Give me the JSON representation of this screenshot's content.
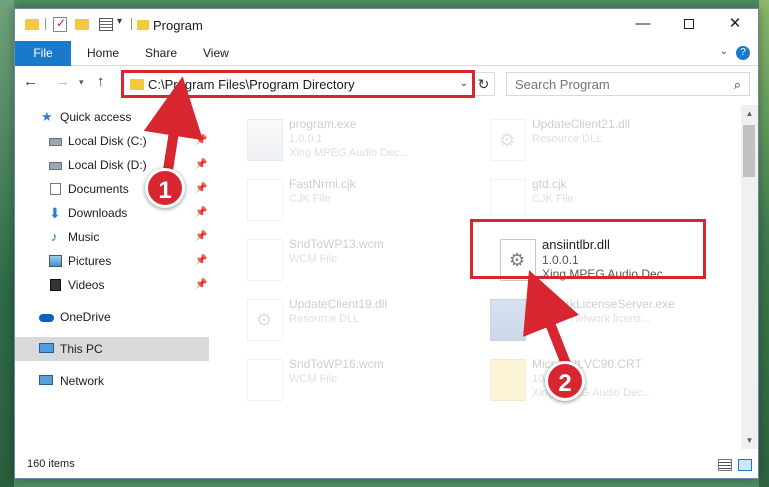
{
  "window": {
    "title": "Program",
    "minimize_icon": "minimize-icon",
    "maximize_icon": "maximize-icon",
    "close_icon": "close-icon"
  },
  "ribbon": {
    "tabs": [
      {
        "label": "File"
      },
      {
        "label": "Home"
      },
      {
        "label": "Share"
      },
      {
        "label": "View"
      }
    ],
    "help": "?"
  },
  "nav": {
    "address": "C:\\Program Files\\Program Directory",
    "search_placeholder": "Search Program"
  },
  "sidebar": {
    "items": [
      {
        "label": "Quick access",
        "icon": "star-icon"
      },
      {
        "label": "Local Disk (C:)",
        "icon": "disk-icon",
        "pinned": true
      },
      {
        "label": "Local Disk (D:)",
        "icon": "disk-icon",
        "pinned": true
      },
      {
        "label": "Documents",
        "icon": "documents-icon",
        "pinned": true
      },
      {
        "label": "Downloads",
        "icon": "downloads-icon",
        "pinned": true
      },
      {
        "label": "Music",
        "icon": "music-icon",
        "pinned": true
      },
      {
        "label": "Pictures",
        "icon": "pictures-icon",
        "pinned": true
      },
      {
        "label": "Videos",
        "icon": "videos-icon",
        "pinned": true
      },
      {
        "label": "OneDrive",
        "icon": "cloud-icon"
      },
      {
        "label": "This PC",
        "icon": "computer-icon",
        "selected": true
      },
      {
        "label": "Network",
        "icon": "network-icon"
      }
    ]
  },
  "files": [
    {
      "name": "program.exe",
      "line2": "1.0.0.1",
      "line3": "Xing MPEG Audio Dec...",
      "icon": "exe-icon"
    },
    {
      "name": "UpdateClient21.dll",
      "line2": "Resource DLL",
      "line3": "",
      "icon": "dll-icon"
    },
    {
      "name": "FastNrml.cjk",
      "line2": "CJK File",
      "line3": "",
      "icon": "file-icon"
    },
    {
      "name": "gtd.cjk",
      "line2": "CJK File",
      "line3": "",
      "icon": "file-icon"
    },
    {
      "name": "SndToWP13.wcm",
      "line2": "WCM File",
      "line3": "",
      "icon": "file-icon"
    },
    {
      "name": "ansiintlbr.dll",
      "line2": "1.0.0.1",
      "line3": "Xing MPEG Audio Dec...",
      "icon": "dll-icon"
    },
    {
      "name": "UpdateClient19.dll",
      "line2": "Resource DLL",
      "line3": "",
      "icon": "dll-icon"
    },
    {
      "name": "NetworkLicenseServer.exe",
      "line2": "ABBYY network licens...",
      "line3": "",
      "icon": "app-icon"
    },
    {
      "name": "SndToWP16.wcm",
      "line2": "WCM File",
      "line3": "",
      "icon": "file-icon"
    },
    {
      "name": "Microsoft.VC90.CRT",
      "line2": "10/...",
      "line3": "Xing MPEG Audio Dec...",
      "icon": "folder-icon"
    }
  ],
  "status": {
    "count": "160 items"
  },
  "annotations": {
    "step1": "1",
    "step2": "2",
    "color": "#d7262f"
  }
}
